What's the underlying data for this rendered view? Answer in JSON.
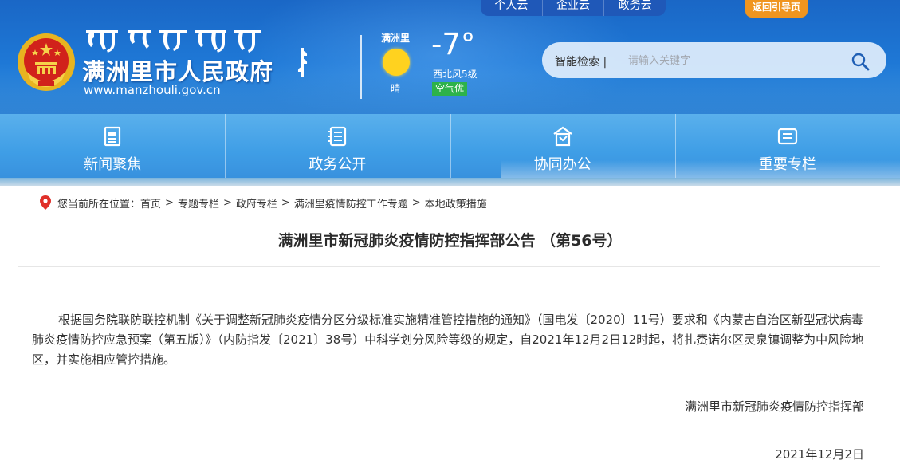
{
  "header": {
    "title": "满洲里市人民政府",
    "url": "www.manzhouli.gov.cn",
    "top_tabs": [
      "个人云",
      "企业云",
      "政务云"
    ],
    "guide_button": "返回引导页",
    "weather": {
      "city": "满洲里",
      "condition": "晴",
      "temperature": "-7°",
      "wind": "西北风5级",
      "air_quality": "空气优",
      "sun_color": "#ffd21f"
    },
    "search": {
      "label": "智能检索 |",
      "placeholder": "请输入关键字",
      "icon": "search-icon"
    }
  },
  "nav": {
    "items": [
      {
        "label": "新闻聚焦",
        "icon": "news-icon"
      },
      {
        "label": "政务公开",
        "icon": "list-icon"
      },
      {
        "label": "协同办公",
        "icon": "office-icon"
      },
      {
        "label": "重要专栏",
        "icon": "column-icon"
      }
    ]
  },
  "breadcrumb": {
    "prefix": "您当前所在位置：",
    "items": [
      "首页",
      "专题专栏",
      "政府专栏",
      "满洲里疫情防控工作专题",
      "本地政策措施"
    ],
    "separator": ">"
  },
  "article": {
    "title": "满洲里市新冠肺炎疫情防控指挥部公告 （第56号）",
    "body": "根据国务院联防联控机制《关于调整新冠肺炎疫情分区分级标准实施精准管控措施的通知》（国电发〔2020〕11号）要求和《内蒙古自治区新型冠状病毒肺炎疫情防控应急预案（第五版）》（内防指发〔2021〕38号）中科学划分风险等级的规定，自2021年12月2日12时起，将扎赉诺尔区灵泉镇调整为中风险地区，并实施相应管控措施。",
    "signature": "满洲里市新冠肺炎疫情防控指挥部",
    "date": "2021年12月2日"
  },
  "colors": {
    "header_blue": "#1e78d6",
    "nav_blue": "#3f9ee6",
    "guide_orange": "#f0951f",
    "aqi_green": "#2db24a",
    "pin_red": "#e0302a"
  }
}
